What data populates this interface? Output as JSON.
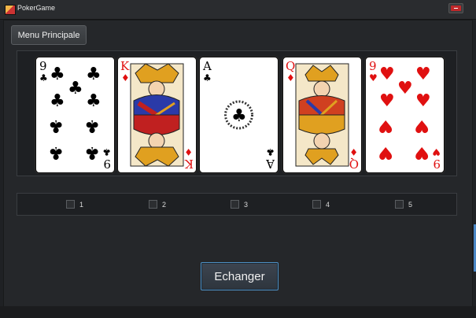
{
  "window": {
    "title": "PokerGame",
    "icon": "app-icon",
    "close_icon": "close-icon"
  },
  "menu": {
    "label": "Menu Principale"
  },
  "cards": [
    {
      "rank": "9",
      "suit": "clubs",
      "suit_symbol": "♣",
      "color": "#000000"
    },
    {
      "rank": "K",
      "suit": "diamonds",
      "suit_symbol": "♦",
      "color": "#e01010"
    },
    {
      "rank": "A",
      "suit": "clubs",
      "suit_symbol": "♣",
      "color": "#000000"
    },
    {
      "rank": "Q",
      "suit": "diamonds",
      "suit_symbol": "♦",
      "color": "#e01010"
    },
    {
      "rank": "9",
      "suit": "hearts",
      "suit_symbol": "♥",
      "color": "#e01010"
    }
  ],
  "checkboxes": [
    {
      "label": "1",
      "checked": false
    },
    {
      "label": "2",
      "checked": false
    },
    {
      "label": "3",
      "checked": false
    },
    {
      "label": "4",
      "checked": false
    },
    {
      "label": "5",
      "checked": false
    }
  ],
  "actions": {
    "exchange_label": "Echanger"
  },
  "colors": {
    "background": "#1f2124",
    "button_border": "#4f8fc2"
  }
}
